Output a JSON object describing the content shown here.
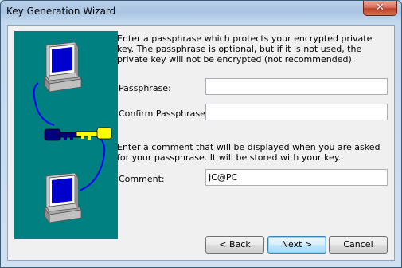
{
  "window": {
    "title": "Key Generation Wizard",
    "close_glyph": "✕"
  },
  "intro_text": "Enter a passphrase which protects your encrypted private key.  The passphrase is optional, but if it is not used, the private key will not be encrypted (not recommended).",
  "fields": {
    "passphrase_label": "Passphrase:",
    "passphrase_value": "",
    "confirm_label": "Confirm Passphrase:",
    "confirm_value": ""
  },
  "comment_text": "Enter a comment that will be displayed when you are asked for your passphrase. It will be stored with your key.",
  "comment": {
    "label": "Comment:",
    "value": "JC@PC"
  },
  "buttons": {
    "back": "< Back",
    "next": "Next >",
    "cancel": "Cancel"
  },
  "illustration": {
    "background_color": "#008080",
    "icons": [
      "computer-icon",
      "key-icon",
      "key-icon",
      "computer-icon"
    ]
  },
  "colors": {
    "accent": "#3c7fb1",
    "close_button": "#c0412a",
    "cable": "#0000ff",
    "key_yellow": "#ffff00",
    "key_navy": "#000080"
  }
}
